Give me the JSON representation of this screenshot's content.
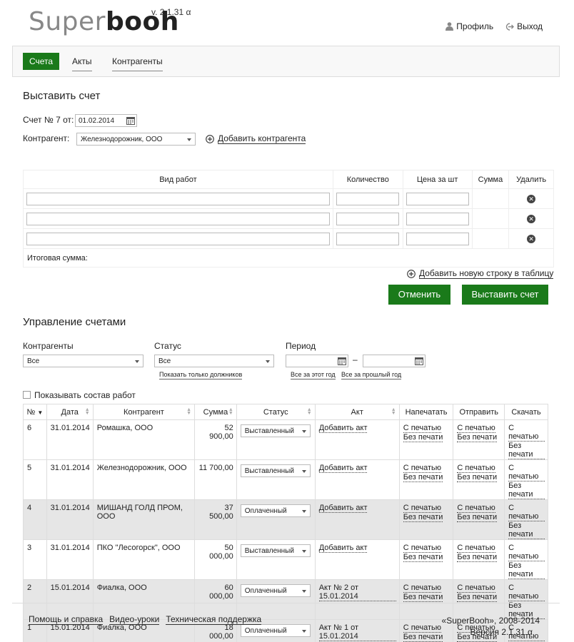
{
  "header": {
    "logo_part1": "Super",
    "logo_part2": "booh",
    "version": "v. 2.1.31 α",
    "profile_label": "Профиль",
    "logout_label": "Выход"
  },
  "nav": {
    "tabs": [
      {
        "label": "Счета",
        "active": true
      },
      {
        "label": "Акты",
        "active": false
      },
      {
        "label": "Контрагенты",
        "active": false
      }
    ]
  },
  "invoice_form": {
    "title": "Выставить счет",
    "invoice_label": "Счет № 7 от:",
    "date_value": "01.02.2014",
    "counterparty_label": "Контрагент:",
    "counterparty_value": "Железнодорожник, ООО",
    "add_counterparty": "Добавить контрагента",
    "table_headers": {
      "work": "Вид работ",
      "qty": "Количество",
      "price": "Цена за шт",
      "sum": "Сумма",
      "delete": "Удалить"
    },
    "total_label": "Итоговая сумма:",
    "add_row": "Добавить новую строку в таблицу",
    "cancel_button": "Отменить",
    "submit_button": "Выставить счет"
  },
  "management": {
    "title": "Управление счетами",
    "filter_counterparties_label": "Контрагенты",
    "filter_counterparties_value": "Все",
    "filter_status_label": "Статус",
    "filter_status_value": "Все",
    "debtors_link": "Показать только должников",
    "period_label": "Период",
    "period_dash": "–",
    "this_year_link": "Все за этот год",
    "last_year_link": "Все за прошлый год",
    "show_works_label": "Показывать состав работ",
    "table_headers": {
      "num": "№",
      "date": "Дата",
      "counterparty": "Контрагент",
      "sum": "Сумма",
      "status": "Статус",
      "act": "Акт",
      "print": "Напечатать",
      "send": "Отправить",
      "download": "Скачать"
    },
    "with_stamp": "С печатью",
    "without_stamp": "Без печати",
    "rows": [
      {
        "num": "6",
        "date": "31.01.2014",
        "counterparty": "Ромашка, ООО",
        "sum": "52 900,00",
        "status": "Выставленный",
        "act": "Добавить акт",
        "paid": false
      },
      {
        "num": "5",
        "date": "31.01.2014",
        "counterparty": "Железнодорожник, ООО",
        "sum": "11 700,00",
        "status": "Выставленный",
        "act": "Добавить акт",
        "paid": false
      },
      {
        "num": "4",
        "date": "31.01.2014",
        "counterparty": "МИШАНД ГОЛД ПРОМ, ООО",
        "sum": "37 500,00",
        "status": "Оплаченный",
        "act": "Добавить акт",
        "paid": true
      },
      {
        "num": "3",
        "date": "31.01.2014",
        "counterparty": "ПКО \"Лесогорск\", ООО",
        "sum": "50 000,00",
        "status": "Выставленный",
        "act": "Добавить акт",
        "paid": false
      },
      {
        "num": "2",
        "date": "15.01.2014",
        "counterparty": "Фиалка, ООО",
        "sum": "60 000,00",
        "status": "Оплаченный",
        "act": "Акт № 2 от 15.01.2014",
        "paid": true
      },
      {
        "num": "1",
        "date": "15.01.2014",
        "counterparty": "Фиалка, ООО",
        "sum": "18 000,00",
        "status": "Оплаченный",
        "act": "Акт № 1 от 15.01.2014",
        "paid": true
      }
    ]
  },
  "footer": {
    "links": [
      "Помощь и справка",
      "Видео-уроки",
      "Техническая поддержка"
    ],
    "copyright": "«SuperBooh», 2008-2014",
    "version": "Версия 2.1.31 α"
  }
}
